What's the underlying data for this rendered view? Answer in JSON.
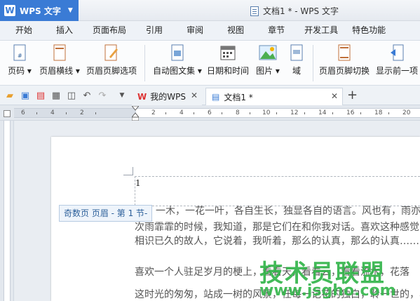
{
  "app": {
    "name": "WPS 文字",
    "logo_letter": "W"
  },
  "window": {
    "title": "文档1 * - WPS 文字"
  },
  "menu": {
    "tabs": [
      "开始",
      "插入",
      "页面布局",
      "引用",
      "审阅",
      "视图",
      "章节",
      "开发工具",
      "特色功能"
    ],
    "active": ""
  },
  "ribbon": {
    "page_number": "页码",
    "header_line": "页眉横线",
    "header_footer_options": "页眉页脚选项",
    "auto_text": "自动图文集",
    "date_time": "日期和时间",
    "picture": "图片",
    "field": "域",
    "switch_header_footer": "页眉页脚切换",
    "show_previous": "显示前一项"
  },
  "tabs": {
    "my_wps": "我的WPS",
    "doc1": "文档1 *"
  },
  "ruler": {
    "labels": [
      "6",
      "4",
      "2",
      "2",
      "4",
      "6",
      "8",
      "10",
      "12",
      "14",
      "16",
      "18",
      "20",
      "22",
      "24"
    ]
  },
  "document": {
    "header_page_number": "1",
    "header_label": "奇数页 页眉 - 第 1 节-",
    "paragraphs": [
      "一木，一花一叶，各自生长，独显各自的语言。风也有，雨亦有",
      "次雨霏霏的时候，我知道，那是它们在和你我对话。喜欢这种感觉，",
      "相识已久的故人，它说着，我听着，那么的认真，那么的认真……",
      "喜欢一个人驻足岁月的梗上，看看天，看看云，看看流水，花落",
      "这时光的匆匆，站成一树的风景，任每一记花的独白，聆一世的，容"
    ]
  },
  "watermark": {
    "line1": "技术员联盟",
    "line2": "www.jsgho.com"
  }
}
